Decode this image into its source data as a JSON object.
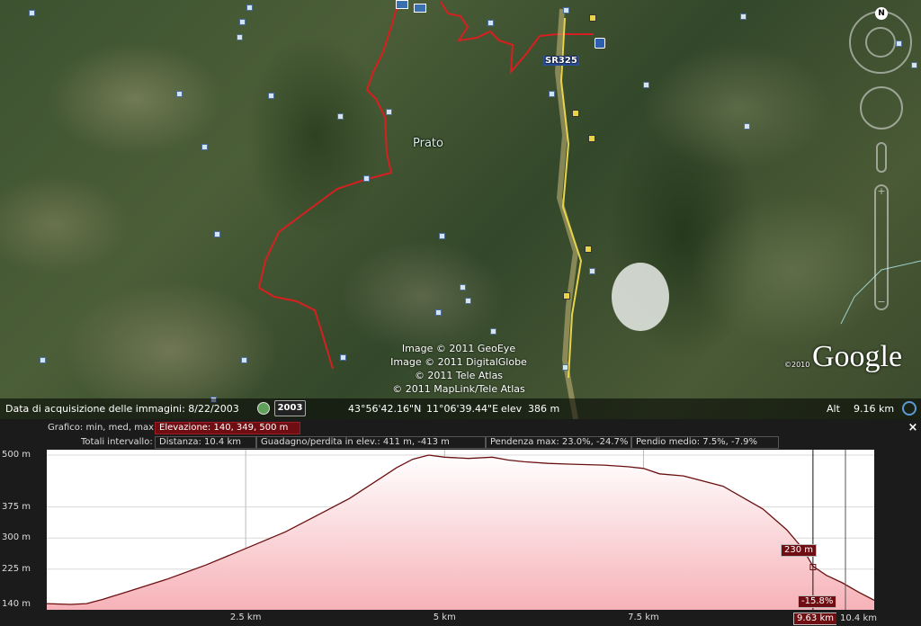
{
  "map": {
    "place_label": "Prato",
    "road_label": "SR325",
    "compass_label": "N",
    "attribution": [
      "Image © 2011 GeoEye",
      "Image © 2011 DigitalGlobe",
      "© 2011 Tele Atlas",
      "© 2011 MapLink/Tele Atlas"
    ],
    "copyright_year": "©2010",
    "brand": "Google",
    "route_color": "#d62020"
  },
  "status_bar": {
    "acquisition_text": "Data di acquisizione delle immagini: 8/22/2003",
    "year_button": "2003",
    "lat": "43°56'42.16\"N",
    "lon": "11°06'39.44\"E",
    "elev_label": "elev",
    "elev_value": "386 m",
    "alt_label": "Alt",
    "alt_value": "9.16 km"
  },
  "profile_panel": {
    "close_label": "×",
    "graph_label": "Grafico: min, med, max",
    "graph_value": "Elevazione: 140, 349, 500 m",
    "totals_label": "Totali intervallo:",
    "distance": "Distanza: 10.4 km",
    "gain_loss": "Guadagno/perdita in elev.: 411 m, -413 m",
    "max_slope": "Pendenza max: 23.0%, -24.7%",
    "avg_slope": "Pendio medio: 7.5%, -7.9%",
    "cursor_elevation": "230 m",
    "cursor_slope": "-15.8%",
    "cursor_distance": "9.63 km",
    "end_distance": "10.4 km"
  },
  "chart_data": {
    "type": "area",
    "title": "",
    "xlabel": "",
    "ylabel": "",
    "x_unit": "km",
    "y_unit": "m",
    "xlim": [
      0,
      10.4
    ],
    "ylim": [
      140,
      500
    ],
    "y_ticks": [
      "140 m",
      "225 m",
      "300 m",
      "375 m",
      "500 m"
    ],
    "y_tick_values": [
      140,
      225,
      300,
      375,
      500
    ],
    "x_ticks": [
      "2.5 km",
      "5 km",
      "7.5 km"
    ],
    "x_tick_values": [
      2.5,
      5,
      7.5
    ],
    "grid": true,
    "fill_color": "#f6b2b8",
    "line_color": "#6b1010",
    "series": [
      {
        "x": [
          0,
          0.3,
          0.5,
          0.7,
          1.0,
          1.5,
          2.0,
          2.5,
          3.0,
          3.5,
          3.8,
          4.0,
          4.2,
          4.4,
          4.6,
          4.8,
          5.0,
          5.3,
          5.6,
          5.8,
          6.0,
          6.3,
          6.6,
          7.0,
          7.3,
          7.5,
          7.7,
          8.0,
          8.5,
          9.0,
          9.3,
          9.5,
          9.63,
          9.8,
          10.0,
          10.2,
          10.4
        ],
        "y": [
          142,
          140,
          142,
          152,
          170,
          200,
          235,
          275,
          315,
          365,
          395,
          420,
          445,
          470,
          490,
          500,
          495,
          492,
          495,
          488,
          484,
          480,
          478,
          476,
          472,
          468,
          455,
          450,
          425,
          370,
          320,
          275,
          232,
          210,
          192,
          170,
          150
        ]
      }
    ],
    "cursor_x": 9.63,
    "cursor_y": 230,
    "end_marker_x": 10.4
  }
}
